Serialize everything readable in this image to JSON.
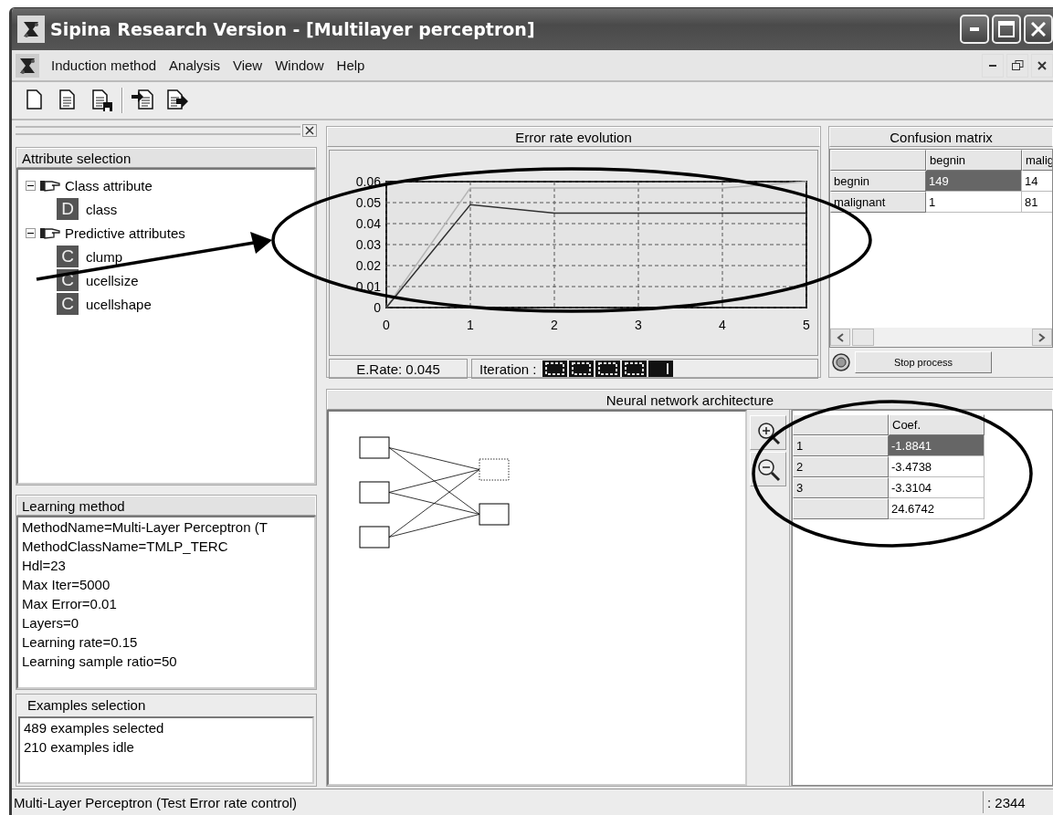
{
  "window": {
    "title": "Sipina Research Version - [Multilayer perceptron]"
  },
  "menu": [
    "Induction method",
    "Analysis",
    "View",
    "Window",
    "Help"
  ],
  "attribute_selection": {
    "title": "Attribute selection",
    "tree": [
      {
        "label": "Class attribute",
        "expanded": true,
        "children": [
          {
            "badge": "D",
            "label": "class"
          }
        ]
      },
      {
        "label": "Predictive attributes",
        "expanded": true,
        "children": [
          {
            "badge": "C",
            "label": "clump"
          },
          {
            "badge": "C",
            "label": "ucellsize"
          },
          {
            "badge": "C",
            "label": "ucellshape"
          }
        ]
      }
    ]
  },
  "learning_method": {
    "title": "Learning method",
    "lines": [
      "MethodName=Multi-Layer Perceptron (T",
      "MethodClassName=TMLP_TERC",
      "Hdl=23",
      "Max Iter=5000",
      "Max Error=0.01",
      "Layers=0",
      "Learning rate=0.15",
      "Learning sample ratio=50"
    ]
  },
  "examples_selection": {
    "title": "Examples selection",
    "lines": [
      "489 examples selected",
      "210 examples idle"
    ]
  },
  "error_rate_evolution": {
    "title": "Error rate evolution",
    "chart_data": {
      "type": "line",
      "x": [
        0,
        1,
        2,
        3,
        4,
        5
      ],
      "xlim": [
        0,
        5
      ],
      "ylim": [
        0,
        0.06
      ],
      "xticks": [
        0,
        1,
        2,
        3,
        4,
        5
      ],
      "yticks": [
        0,
        0.01,
        0.02,
        0.03,
        0.04,
        0.05,
        0.06
      ],
      "grid": true,
      "series": [
        {
          "color": "#b4b4b4",
          "values": [
            0,
            0.057,
            0.057,
            0.057,
            0.057,
            0.06
          ]
        },
        {
          "color": "#303030",
          "values": [
            0,
            0.049,
            0.045,
            0.045,
            0.045,
            0.045
          ]
        }
      ]
    },
    "error_rate": "E.Rate: 0.045",
    "iteration_label": "Iteration :"
  },
  "confusion_matrix": {
    "title": "Confusion matrix",
    "columns": [
      "begnin",
      "malig"
    ],
    "rows": [
      {
        "label": "begnin",
        "cells": [
          {
            "text": "149",
            "selected": true
          },
          {
            "text": "14",
            "selected": false
          }
        ]
      },
      {
        "label": "malignant",
        "cells": [
          {
            "text": "1",
            "selected": false
          },
          {
            "text": "81",
            "selected": false
          }
        ]
      }
    ],
    "stop_button": "Stop process"
  },
  "network": {
    "title": "Neural network architecture",
    "input_nodes": [
      {
        "kind": "solid"
      },
      {
        "kind": "solid"
      },
      {
        "kind": "solid"
      }
    ],
    "output_nodes": [
      {
        "kind": "dotted"
      },
      {
        "kind": "solid"
      }
    ],
    "coefficients": {
      "column": "Coef.",
      "rows": [
        {
          "label": "1",
          "value": "-1.8841",
          "selected": true
        },
        {
          "label": "2",
          "value": "-3.4738",
          "selected": false
        },
        {
          "label": "3",
          "value": "-3.3104",
          "selected": false
        },
        {
          "value": "24.6742",
          "selected": false
        }
      ]
    }
  },
  "status_bar": {
    "message": "Multi-Layer Perceptron (Test Error rate control)",
    "count": ": 2344"
  }
}
